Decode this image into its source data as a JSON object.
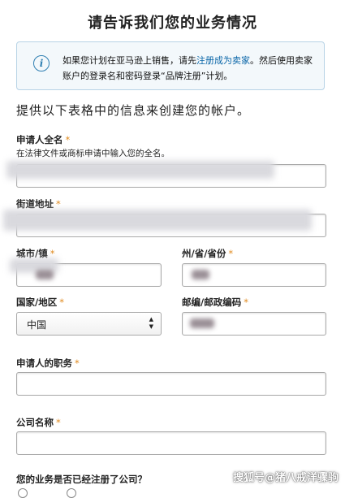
{
  "page": {
    "title": "请告诉我们您的业务情况"
  },
  "info": {
    "icon": "info-icon",
    "text_before_link": "如果您计划在亚马逊上销售，请先",
    "link_text": "注册成为卖家",
    "text_after_link": "。然后使用卖家账户的登录名和密码登录“品牌注册”计划。"
  },
  "form": {
    "section_heading": "提供以下表格中的信息来创建您的帐户。",
    "required_marker": "*",
    "applicant_name": {
      "label": "申请人全名",
      "hint": "在法律文件或商标申请中输入您的全名。",
      "value": ""
    },
    "street_address": {
      "label": "街道地址",
      "value": ""
    },
    "city": {
      "label": "城市/镇",
      "value": ""
    },
    "state": {
      "label": "州/省/省份",
      "value": ""
    },
    "country": {
      "label": "国家/地区",
      "selected": "中国"
    },
    "postal_code": {
      "label": "邮编/邮政编码",
      "value": ""
    },
    "job_title": {
      "label": "申请人的职务",
      "value": ""
    },
    "company_name": {
      "label": "公司名称",
      "value": ""
    },
    "registered_question": "您的业务是否已经注册了公司？"
  },
  "watermark": "搜狐号@猪八戒洋骤驹",
  "colors": {
    "required": "#e08a1e",
    "link": "#0a66a8",
    "info_border": "#b7d3e6",
    "info_background": "#f3f8fb"
  }
}
